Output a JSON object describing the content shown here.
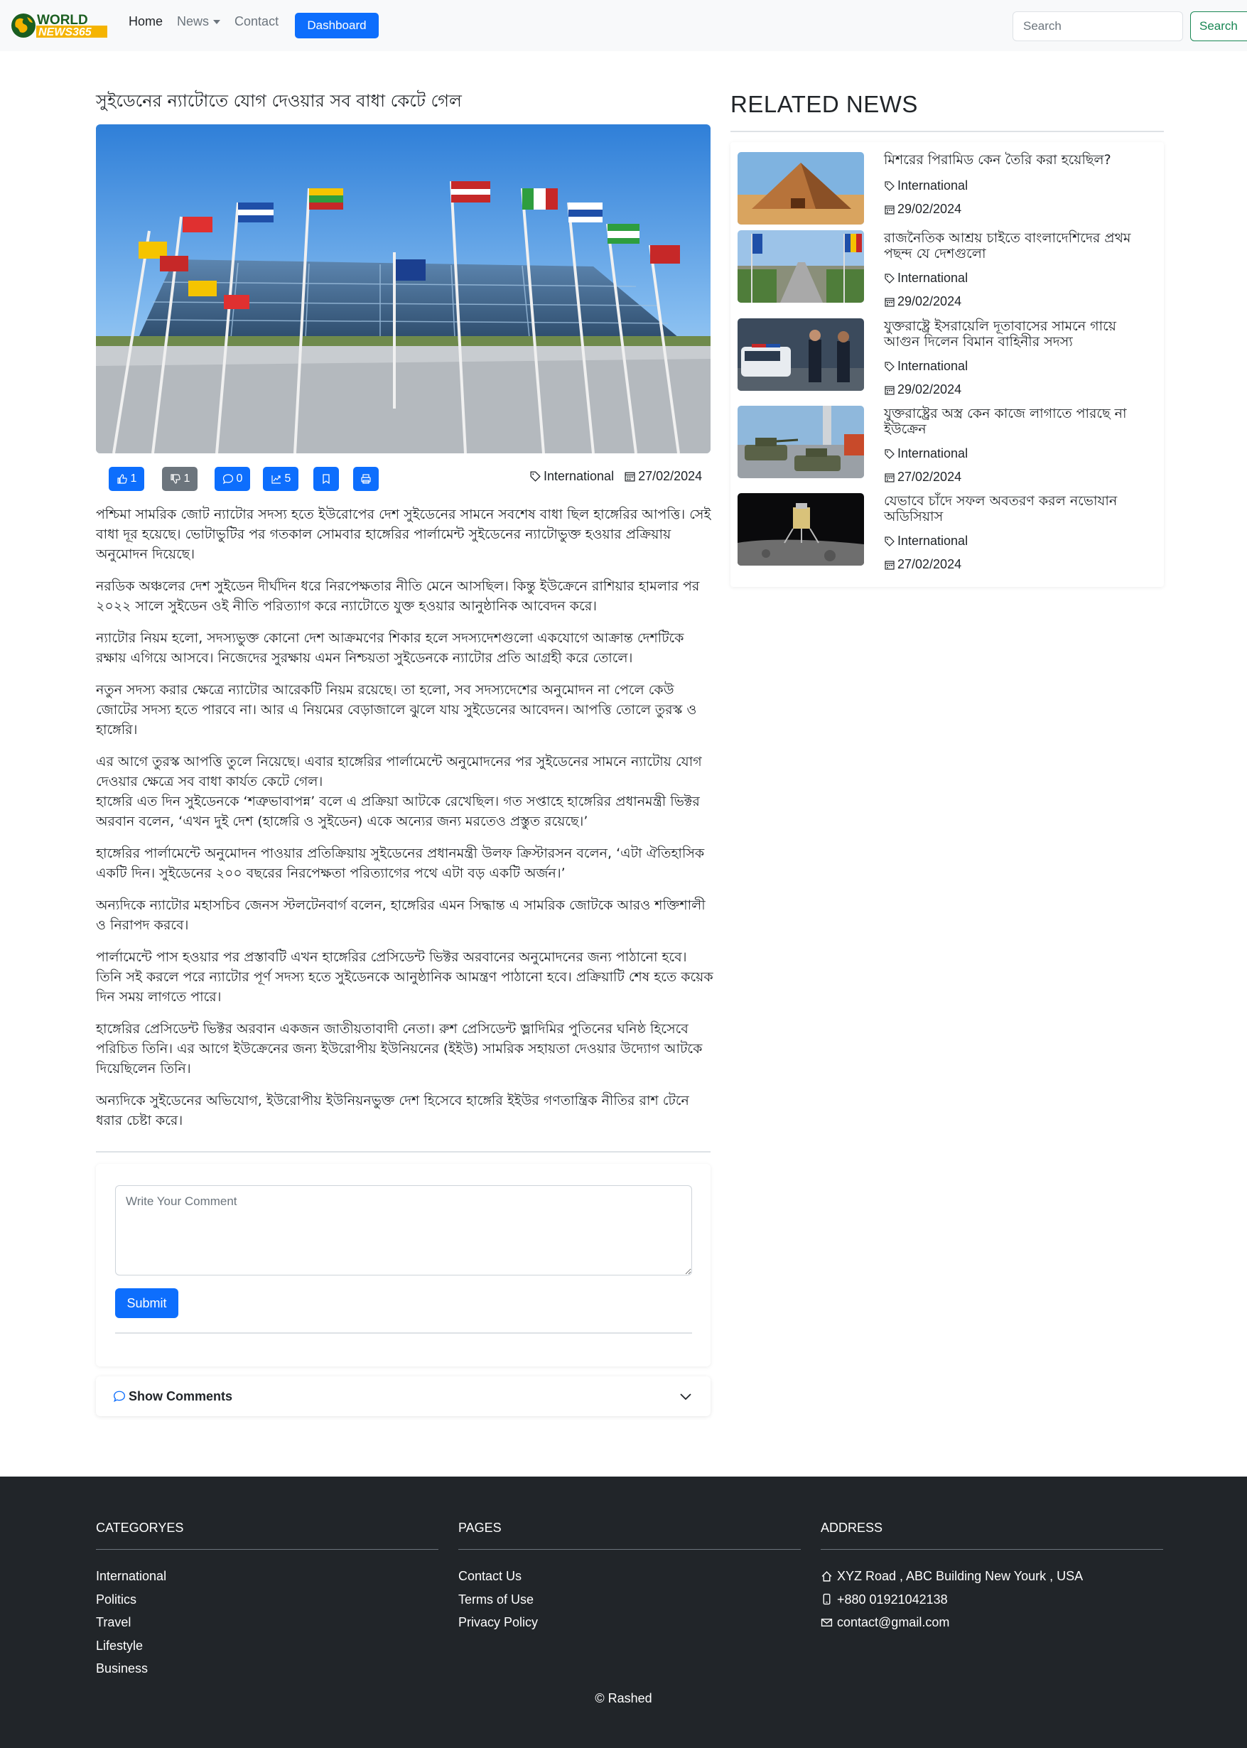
{
  "brand": {
    "logo_line1": "WORLD",
    "logo_line2": "NEWS365",
    "colors": {
      "primary": "#0d6efd",
      "secondary": "#6c757d",
      "success": "#198754",
      "footer_bg": "#212529",
      "logo_green": "#1b5e20",
      "logo_yellow": "#f5b400"
    }
  },
  "nav": {
    "home": "Home",
    "news": "News",
    "contact": "Contact",
    "dashboard": "Dashboard",
    "search_placeholder": "Search",
    "search_button": "Search"
  },
  "article": {
    "title": "সুইডেনের ন্যাটোতে যোগ দেওয়ার সব বাধা কেটে গেল",
    "image_subject": "nato-headquarters-flags",
    "actions": {
      "likes": "1",
      "dislikes": "1",
      "comments": "0",
      "shares": "5"
    },
    "category": "International",
    "date": "27/02/2024",
    "paragraphs": [
      "পশ্চিমা সামরিক জোট ন্যাটোর সদস্য হতে ইউরোপের দেশ সুইডেনের সামনে সবশেষ বাধা ছিল হাঙ্গেরির আপত্তি। সেই বাধা দূর হয়েছে। ভোটাভুটির পর গতকাল সোমবার হাঙ্গেরির পার্লামেন্ট সুইডেনের ন্যাটোভুক্ত হওয়ার প্রক্রিয়ায় অনুমোদন দিয়েছে।",
      "নরডিক অঞ্চলের দেশ সুইডেন দীর্ঘদিন ধরে নিরপেক্ষতার নীতি মেনে আসছিল। কিন্তু ইউক্রেনে রাশিয়ার হামলার পর ২০২২ সালে সুইডেন ওই নীতি পরিত্যাগ করে ন্যাটোতে যুক্ত হওয়ার আনুষ্ঠানিক আবেদন করে।",
      "ন্যাটোর নিয়ম হলো, সদস্যভুক্ত কোনো দেশ আক্রমণের শিকার হলে সদস্যদেশগুলো একযোগে আক্রান্ত দেশটিকে রক্ষায় এগিয়ে আসবে। নিজেদের সুরক্ষায় এমন নিশ্চয়তা সুইডেনকে ন্যাটোর প্রতি আগ্রহী করে তোলে।",
      "নতুন সদস্য করার ক্ষেত্রে ন্যাটোর আরেকটি নিয়ম রয়েছে। তা হলো, সব সদস্যদেশের অনুমোদন না পেলে কেউ জোটের সদস্য হতে পারবে না। আর এ নিয়মের বেড়াজালে ঝুলে যায় সুইডেনের আবেদন। আপত্তি তোলে তুরস্ক ও হাঙ্গেরি।",
      "এর আগে তুরস্ক আপত্তি তুলে নিয়েছে। এবার হাঙ্গেরির পার্লামেন্টে অনুমোদনের পর সুইডেনের সামনে ন্যাটোয় যোগ দেওয়ার ক্ষেত্রে সব বাধা কার্যত কেটে গেল।\nহাঙ্গেরি এত দিন সুইডেনকে ‘শত্রুভাবাপন্ন’ বলে এ প্রক্রিয়া আটকে রেখেছিল। গত সপ্তাহে হাঙ্গেরির প্রধানমন্ত্রী ভিক্টর অরবান বলেন, ‘এখন দুই দেশ (হাঙ্গেরি ও সুইডেন) একে অন্যের জন্য মরতেও প্রস্তুত রয়েছে।’",
      "হাঙ্গেরির পার্লামেন্টে অনুমোদন পাওয়ার প্রতিক্রিয়ায় সুইডেনের প্রধানমন্ত্রী উলফ ক্রিস্টারসন বলেন, ‘এটা ঐতিহাসিক একটি দিন। সুইডেনের ২০০ বছরের নিরপেক্ষতা পরিত্যাগের পথে এটা বড় একটি অর্জন।’",
      "অন্যদিকে ন্যাটোর মহাসচিব জেনস স্টলটেনবার্গ বলেন, হাঙ্গেরির এমন সিদ্ধান্ত এ সামরিক জোটকে আরও শক্তিশালী ও নিরাপদ করবে।",
      "পার্লামেন্টে পাস হওয়ার পর প্রস্তাবটি এখন হাঙ্গেরির প্রেসিডেন্ট ভিক্টর অরবানের অনুমোদনের জন্য পাঠানো হবে। তিনি সই করলে পরে ন্যাটোর পূর্ণ সদস্য হতে সুইডেনকে আনুষ্ঠানিক আমন্ত্রণ পাঠানো হবে। প্রক্রিয়াটি শেষ হতে কয়েক দিন সময় লাগতে পারে।",
      "হাঙ্গেরির প্রেসিডেন্ট ভিক্টর অরবান একজন জাতীয়তাবাদী নেতা। রুশ প্রেসিডেন্ট ভ্লাদিমির পুতিনের ঘনিষ্ঠ হিসেবে পরিচিত তিনি। এর আগে ইউক্রেনের জন্য ইউরোপীয় ইউনিয়নের (ইইউ) সামরিক সহায়তা দেওয়ার উদ্যোগ আটকে দিয়েছিলেন তিনি।",
      "অন্যদিকে সুইডেনের অভিযোগ, ইউরোপীয় ইউনিয়নভুক্ত দেশ হিসেবে হাঙ্গেরি ইইউর গণতান্ত্রিক নীতির রাশ টেনে ধরার চেষ্টা করে।"
    ]
  },
  "comments": {
    "placeholder": "Write Your Comment",
    "submit": "Submit",
    "show_comments": "Show Comments"
  },
  "related": {
    "heading": "RELATED NEWS",
    "items": [
      {
        "title": "মিশরের পিরামিড কেন তৈরি করা হয়েছিল?",
        "category": "International",
        "date": "29/02/2024",
        "thumb": "pyramid"
      },
      {
        "title": "রাজনৈতিক আশ্রয় চাইতে বাংলাদেশিদের প্রথম পছন্দ যে দেশগুলো",
        "category": "International",
        "date": "29/02/2024",
        "thumb": "city-flags"
      },
      {
        "title": "যুক্তরাষ্ট্রে ইসরায়েলি দূতাবাসের সামনে গায়ে আগুন দিলেন বিমান বাহিনীর সদস্য",
        "category": "International",
        "date": "29/02/2024",
        "thumb": "police"
      },
      {
        "title": "যুক্তরাষ্ট্রের অস্ত্র কেন কাজে লাগাতে পারছে না ইউক্রেন",
        "category": "International",
        "date": "27/02/2024",
        "thumb": "tanks"
      },
      {
        "title": "যেভাবে চাঁদে সফল অবতরণ করল নভোযান অডিসিয়াস",
        "category": "International",
        "date": "27/02/2024",
        "thumb": "lunar-lander"
      }
    ]
  },
  "footer": {
    "categories_heading": "CATEGORYES",
    "categories": [
      "International",
      "Politics",
      "Travel",
      "Lifestyle",
      "Business"
    ],
    "pages_heading": "PAGES",
    "pages": [
      "Contact Us",
      "Terms of Use",
      "Privacy Policy"
    ],
    "address_heading": "ADDRESS",
    "address": "XYZ Road , ABC Building New Yourk , USA",
    "phone": "+880 01921042138",
    "email": "contact@gmail.com",
    "copyright": "© Rashed"
  }
}
